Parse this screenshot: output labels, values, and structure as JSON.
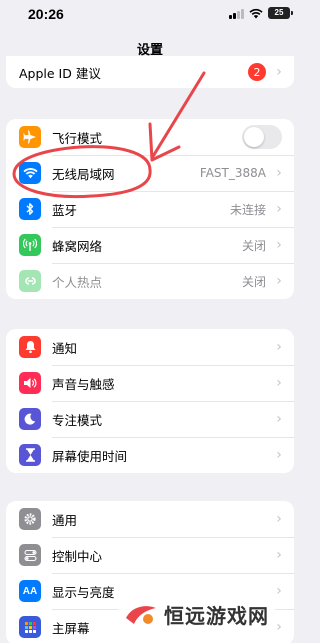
{
  "status_bar": {
    "time": "20:26",
    "battery": "25"
  },
  "title": "设置",
  "apple_id": {
    "label": "Apple ID 建议",
    "badge": "2"
  },
  "connectivity": [
    {
      "name": "airplane",
      "label": "飞行模式",
      "value": "",
      "icon": "airplane-icon",
      "color": "#ff9500"
    },
    {
      "name": "wlan",
      "label": "无线局域网",
      "value": "FAST_388A",
      "icon": "wifi-icon",
      "color": "#007aff"
    },
    {
      "name": "bluetooth",
      "label": "蓝牙",
      "value": "未连接",
      "icon": "bluetooth-icon",
      "color": "#007aff"
    },
    {
      "name": "cellular",
      "label": "蜂窝网络",
      "value": "关闭",
      "icon": "antenna-icon",
      "color": "#34c759"
    },
    {
      "name": "hotspot",
      "label": "个人热点",
      "value": "关闭",
      "icon": "hotspot-icon",
      "color": "#34c759"
    }
  ],
  "notifications_group": [
    {
      "name": "notifications",
      "label": "通知",
      "icon": "bell-icon",
      "color": "#ff3b30"
    },
    {
      "name": "sounds",
      "label": "声音与触感",
      "icon": "speaker-icon",
      "color": "#ff2d55"
    },
    {
      "name": "focus",
      "label": "专注模式",
      "icon": "moon-icon",
      "color": "#5856d6"
    },
    {
      "name": "screen-time",
      "label": "屏幕使用时间",
      "icon": "hourglass-icon",
      "color": "#5856d6"
    }
  ],
  "general_group": [
    {
      "name": "general",
      "label": "通用",
      "icon": "gear-icon",
      "color": "#8e8e93"
    },
    {
      "name": "control-center",
      "label": "控制中心",
      "icon": "switches-icon",
      "color": "#8e8e93"
    },
    {
      "name": "display",
      "label": "显示与亮度",
      "icon": "aa-icon",
      "color": "#007aff"
    },
    {
      "name": "home-screen",
      "label": "主屏幕",
      "icon": "grid-icon",
      "color": "#007aff"
    }
  ],
  "airplane_toggle": "off",
  "watermark": {
    "text": "恒远游戏网"
  }
}
